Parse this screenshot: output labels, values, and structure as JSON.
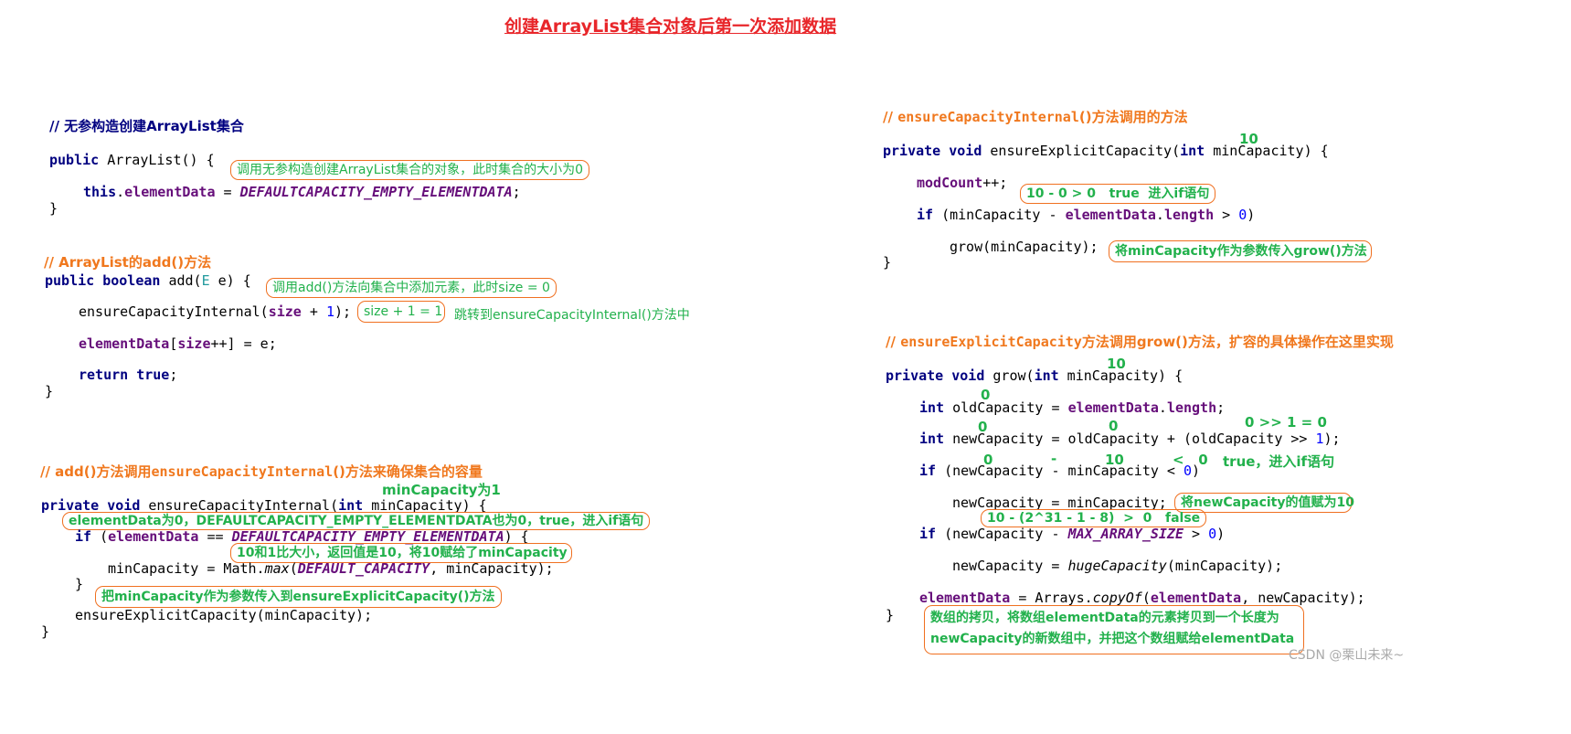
{
  "title": "创建ArrayList集合对象后第一次添加数据",
  "watermark": "CSDN @栗山未来~",
  "left": {
    "comment1": "// 无参构造创建ArrayList集合",
    "c1": {
      "l1a": "public",
      "l1b": " ArrayList() {",
      "l2a": "this",
      "l2b": ".",
      "l2c": "elementData",
      "l2d": " = ",
      "l2e": "DEFAULTCAPACITY_EMPTY_ELEMENTDATA",
      "l2f": ";",
      "l3": "}"
    },
    "note1": "调用无参构造创建ArrayList集合的对象，此时集合的大小为0",
    "comment2": "// ArrayList的add()方法",
    "c2": {
      "l1a": "public",
      "l1b": " ",
      "l1c": "boolean",
      "l1d": " add(",
      "l1e": "E",
      "l1f": " e) {",
      "l2a": "ensureCapacityInternal(",
      "l2b": "size",
      "l2c": " + ",
      "l2d": "1",
      "l2e": ");",
      "l3a": "elementData",
      "l3b": "[",
      "l3c": "size",
      "l3d": "++] = e;",
      "l4a": "return",
      "l4b": " ",
      "l4c": "true",
      "l4d": ";",
      "l5": "}"
    },
    "note2": "调用add()方法向集合中添加元素，此时size = 0",
    "note3": "size + 1 = 1",
    "note4": "跳转到ensureCapacityInternal()方法中",
    "comment3a": "// add()方法调用",
    "comment3b": "ensureCapacityInternal",
    "comment3c": "()方法来确保集合的容量",
    "label_min": "minCapacity为1",
    "c3": {
      "l1a": "private",
      "l1b": " ",
      "l1c": "void",
      "l1d": " ensureCapacityInternal(",
      "l1e": "int",
      "l1f": " minCapacity) {",
      "l2a": "if",
      "l2b": " (",
      "l2c": "elementData",
      "l2d": " == ",
      "l2e": "DEFAULTCAPACITY_EMPTY_ELEMENTDATA",
      "l2f": ") {",
      "l3a": "minCapacity = Math.",
      "l3b": "max",
      "l3c": "(",
      "l3d": "DEFAULT_CAPACITY",
      "l3e": ", minCapacity);",
      "l4": "}",
      "l5": "ensureExplicitCapacity(minCapacity);",
      "l6": "}"
    },
    "note5": "elementData为0，DEFAULTCAPACITY_EMPTY_ELEMENTDATA也为0，true，进入if语句",
    "note6": "10和1比大小，返回值是10，将10赋给了minCapacity",
    "note7": "把minCapacity作为参数传入到ensureExplicitCapacity()方法"
  },
  "right": {
    "comment1a": "// ",
    "comment1b": "ensureCapacityInternal",
    "comment1c": "()方法调用的方法",
    "label10a": "10",
    "c1": {
      "l1a": "private",
      "l1b": " ",
      "l1c": "void",
      "l1d": " ensureExplicitCapacity(",
      "l1e": "int",
      "l1f": " minCapacity) {",
      "l2a": "modCount",
      "l2b": "++;",
      "l3a": "if",
      "l3b": " (minCapacity - ",
      "l3c": "elementData",
      "l3d": ".",
      "l3e": "length",
      "l3f": " > ",
      "l3g": "0",
      "l3h": ")",
      "l4": "grow(minCapacity);",
      "l5": "}"
    },
    "note1": "10 - 0 > 0   true  进入if语句",
    "note2": "将minCapacity作为参数传入grow()方法",
    "comment2a": "// ",
    "comment2b": "ensureExplicitCapacity",
    "comment2c": "方法调用grow()方法，扩容的具体操作在这里实现",
    "label10b": "10",
    "c2": {
      "l1a": "private",
      "l1b": " ",
      "l1c": "void",
      "l1d": " grow(",
      "l1e": "int",
      "l1f": " minCapacity) {",
      "l2a": "int",
      "l2b": " oldCapacity = ",
      "l2c": "elementData",
      "l2d": ".",
      "l2e": "length",
      "l2f": ";",
      "l3a": "int",
      "l3b": " newCapacity = oldCapacity + (oldCapacity >> ",
      "l3c": "1",
      "l3d": ");",
      "l4a": "if",
      "l4b": " (newCapacity - minCapacity < ",
      "l4c": "0",
      "l4d": ")",
      "l5": "newCapacity = minCapacity;",
      "l6a": "if",
      "l6b": " (newCapacity - ",
      "l6c": "MAX_ARRAY_SIZE",
      "l6d": " > ",
      "l6e": "0",
      "l6f": ")",
      "l7a": "newCapacity = ",
      "l7b": "hugeCapacity",
      "l7c": "(minCapacity);",
      "l8a": "elementData",
      "l8b": " = Arrays.",
      "l8c": "copyOf",
      "l8d": "(",
      "l8e": "elementData",
      "l8f": ", newCapacity);",
      "l9": "}"
    },
    "lbl_old0": "0",
    "lbl_new0": "0",
    "lbl_old0b": "0",
    "lbl_shift": "0 >> 1 = 0",
    "lbl_if0": "0",
    "lbl_minus": "-",
    "lbl_if10": "10",
    "lbl_lt0": "<   0",
    "lbl_true": "true，进入if语句",
    "note3": "将newCapacity的值赋为10",
    "note4": "10 - (2^31 - 1 - 8)  >  0   false",
    "note5a": "数组的拷贝，将数组elementData的元素拷贝到一个长度为",
    "note5b": "newCapacity的新数组中，并把这个数组赋给elementData"
  }
}
